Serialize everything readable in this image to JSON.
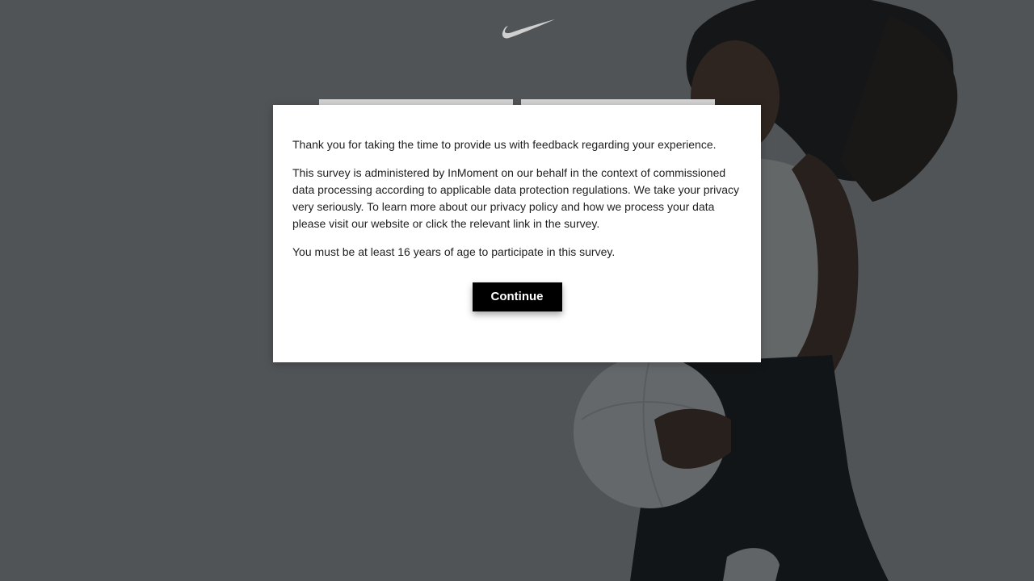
{
  "brand": {
    "logo_icon": "nike-swoosh-icon"
  },
  "modal": {
    "paragraphs": [
      "Thank you for taking the time to provide us with feedback regarding your experience.",
      "This survey is administered by InMoment on our behalf in the context of commissioned data processing according to applicable data protection regulations. We take your privacy very seriously. To learn more about our privacy policy and how we process your data please visit our website or click the relevant link in the survey.",
      "You must be at least 16 years of age to participate in this survey."
    ],
    "continue_label": "Continue"
  },
  "colors": {
    "overlay": "#3b3f43",
    "button_bg": "#000000",
    "button_text": "#ffffff",
    "modal_bg": "#ffffff"
  }
}
